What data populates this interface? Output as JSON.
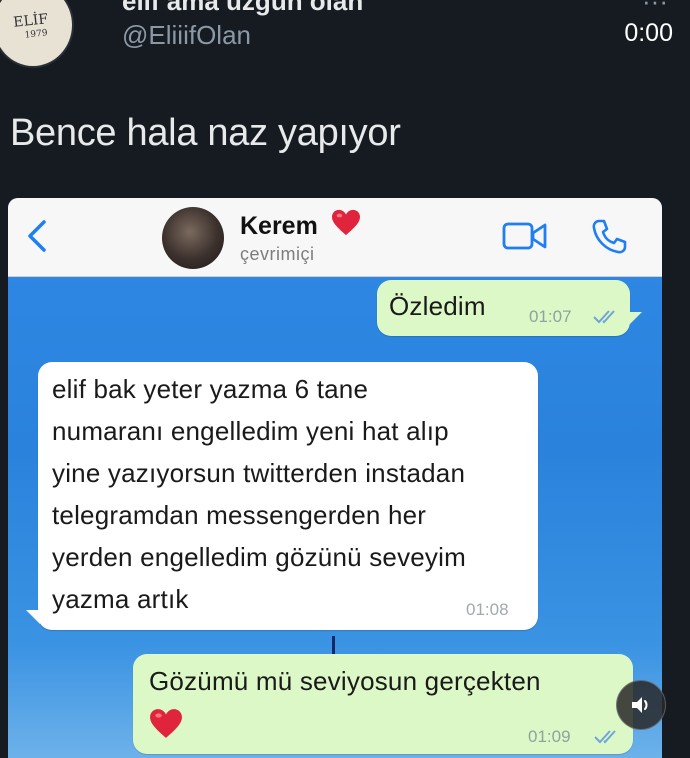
{
  "tweet": {
    "avatar_text": "ELİF",
    "avatar_year": "1979",
    "display_name": "elif ama üzgün olan",
    "handle": "@EliiifOlan",
    "more_glyph": "···",
    "video_timer": "0:00",
    "text": "Bence hala naz yapıyor"
  },
  "chat": {
    "contact_name": "Kerem",
    "contact_status": "çevrimiçi",
    "accent_blue": "#2f86dd",
    "outgoing_color": "#dcf8c6",
    "heart_color": "#e0243b",
    "messages": [
      {
        "direction": "out",
        "lines": [
          "Özledim"
        ],
        "time": "01:07",
        "read": true
      },
      {
        "direction": "in",
        "lines": [
          "elif bak yeter yazma 6 tane",
          "numaranı engelledim yeni hat alıp",
          "yine yazıyorsun twitterden instadan",
          "telegramdan messengerden her",
          "yerden engelledim gözünü seveyim",
          "yazma artık"
        ],
        "time": "01:08"
      },
      {
        "direction": "out",
        "lines": [
          "Gözümü mü seviyosun gerçekten"
        ],
        "emoji": "heart",
        "time": "01:09",
        "read": true
      }
    ]
  },
  "icons": {
    "back": "chevron-left-icon",
    "video": "video-camera-icon",
    "phone": "phone-icon",
    "sound": "speaker-icon"
  }
}
